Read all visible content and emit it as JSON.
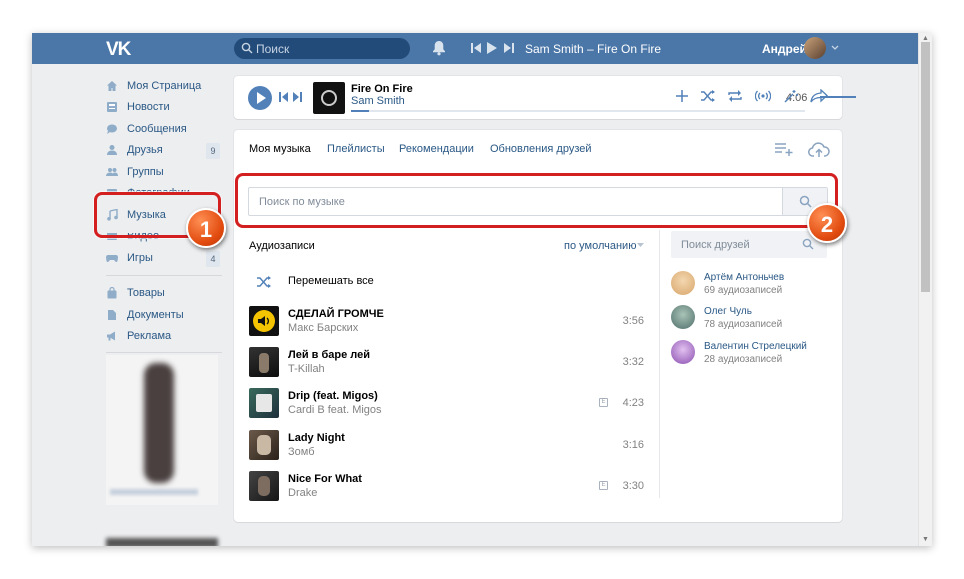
{
  "topbar": {
    "logo": "VK",
    "search_placeholder": "Поиск",
    "now_playing": "Sam Smith – Fire On Fire",
    "user_name": "Андрей"
  },
  "sidebar": {
    "items": [
      {
        "label": "Моя Страница",
        "icon": "user-icon"
      },
      {
        "label": "Новости",
        "icon": "news-icon"
      },
      {
        "label": "Сообщения",
        "icon": "message-icon"
      },
      {
        "label": "Друзья",
        "icon": "friends-icon",
        "count": "9"
      },
      {
        "label": "Группы",
        "icon": "groups-icon"
      },
      {
        "label": "Фотографии",
        "icon": "photo-icon"
      },
      {
        "label": "Музыка",
        "icon": "music-icon"
      },
      {
        "label": "Видео",
        "icon": "video-icon"
      },
      {
        "label": "Игры",
        "icon": "gamepad-icon",
        "count": "4"
      },
      {
        "label": "Товары",
        "icon": "shopping-bag-icon"
      },
      {
        "label": "Документы",
        "icon": "document-icon"
      },
      {
        "label": "Реклама",
        "icon": "megaphone-icon"
      }
    ]
  },
  "player": {
    "title": "Fire On Fire",
    "artist": "Sam Smith",
    "time": "4:06",
    "progress_fraction": 0.04
  },
  "music": {
    "tabs": [
      "Моя музыка",
      "Плейлисты",
      "Рекомендации",
      "Обновления друзей"
    ],
    "search_placeholder": "Поиск по музыке",
    "section_title": "Аудиозаписи",
    "sort_label": "по умолчанию",
    "shuffle_label": "Перемешать все",
    "tracks": [
      {
        "title": "СДЕЛАЙ ГРОМЧЕ",
        "artist": "Макс Барских",
        "duration": "3:56",
        "explicit": false
      },
      {
        "title": "Лей в баре лей",
        "artist": "T-Killah",
        "duration": "3:32",
        "explicit": false
      },
      {
        "title": "Drip (feat. Migos)",
        "artist": "Cardi B feat. Migos",
        "duration": "4:23",
        "explicit": true,
        "explicit_mark": "E"
      },
      {
        "title": "Lady Night",
        "artist": "Зомб",
        "duration": "3:16",
        "explicit": false
      },
      {
        "title": "Nice For What",
        "artist": "Drake",
        "duration": "3:30",
        "explicit": true,
        "explicit_mark": "E"
      }
    ]
  },
  "friends": {
    "search_placeholder": "Поиск друзей",
    "list": [
      {
        "name": "Артём Антоньчев",
        "count": "69 аудиозаписей"
      },
      {
        "name": "Олег Чуль",
        "count": "78 аудиозаписей"
      },
      {
        "name": "Валентин Стрелецкий",
        "count": "28 аудиозаписей"
      }
    ]
  },
  "annotations": {
    "badge_1": "1",
    "badge_2": "2",
    "highlight_color": "#d31f1f",
    "badge_color": "#e14a0e"
  },
  "colors": {
    "header": "#4a76a8",
    "link": "#2a5885",
    "accent": "#5181b8",
    "background": "#edeef0"
  }
}
